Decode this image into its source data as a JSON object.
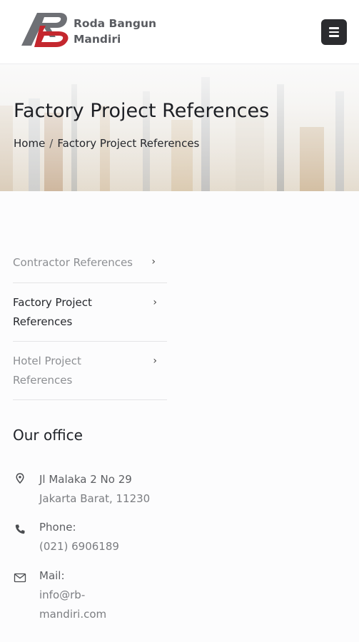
{
  "header": {
    "brand_line1": "Roda Bangun",
    "brand_line2": "Mandiri",
    "logo_icon": "rb-monogram-logo",
    "menu_icon": "hamburger-menu-icon"
  },
  "banner": {
    "title": "Factory Project References",
    "breadcrumb": {
      "home": "Home",
      "separator": "/",
      "current": "Factory Project References"
    }
  },
  "categories": {
    "items": [
      {
        "label": "Contractor References",
        "active": false
      },
      {
        "label_line1": "Factory Project",
        "label_line2": "References",
        "active": true
      },
      {
        "label_line1": "Hotel Project",
        "label_line2": "References",
        "active": false
      }
    ],
    "chevron": "›"
  },
  "office": {
    "title": "Our office",
    "address_line1": "Jl Malaka 2 No 29",
    "address_line2": "Jakarta Barat, 11230",
    "phone_label": "Phone:",
    "phone_value": "(021) 6906189",
    "mail_label": "Mail:",
    "mail_line1": "info@rb-",
    "mail_line2": "mandiri.com"
  },
  "colors": {
    "brand_red": "#c4272e",
    "logo_gray": "#6e7075",
    "menu_button": "#2b2c2f"
  }
}
